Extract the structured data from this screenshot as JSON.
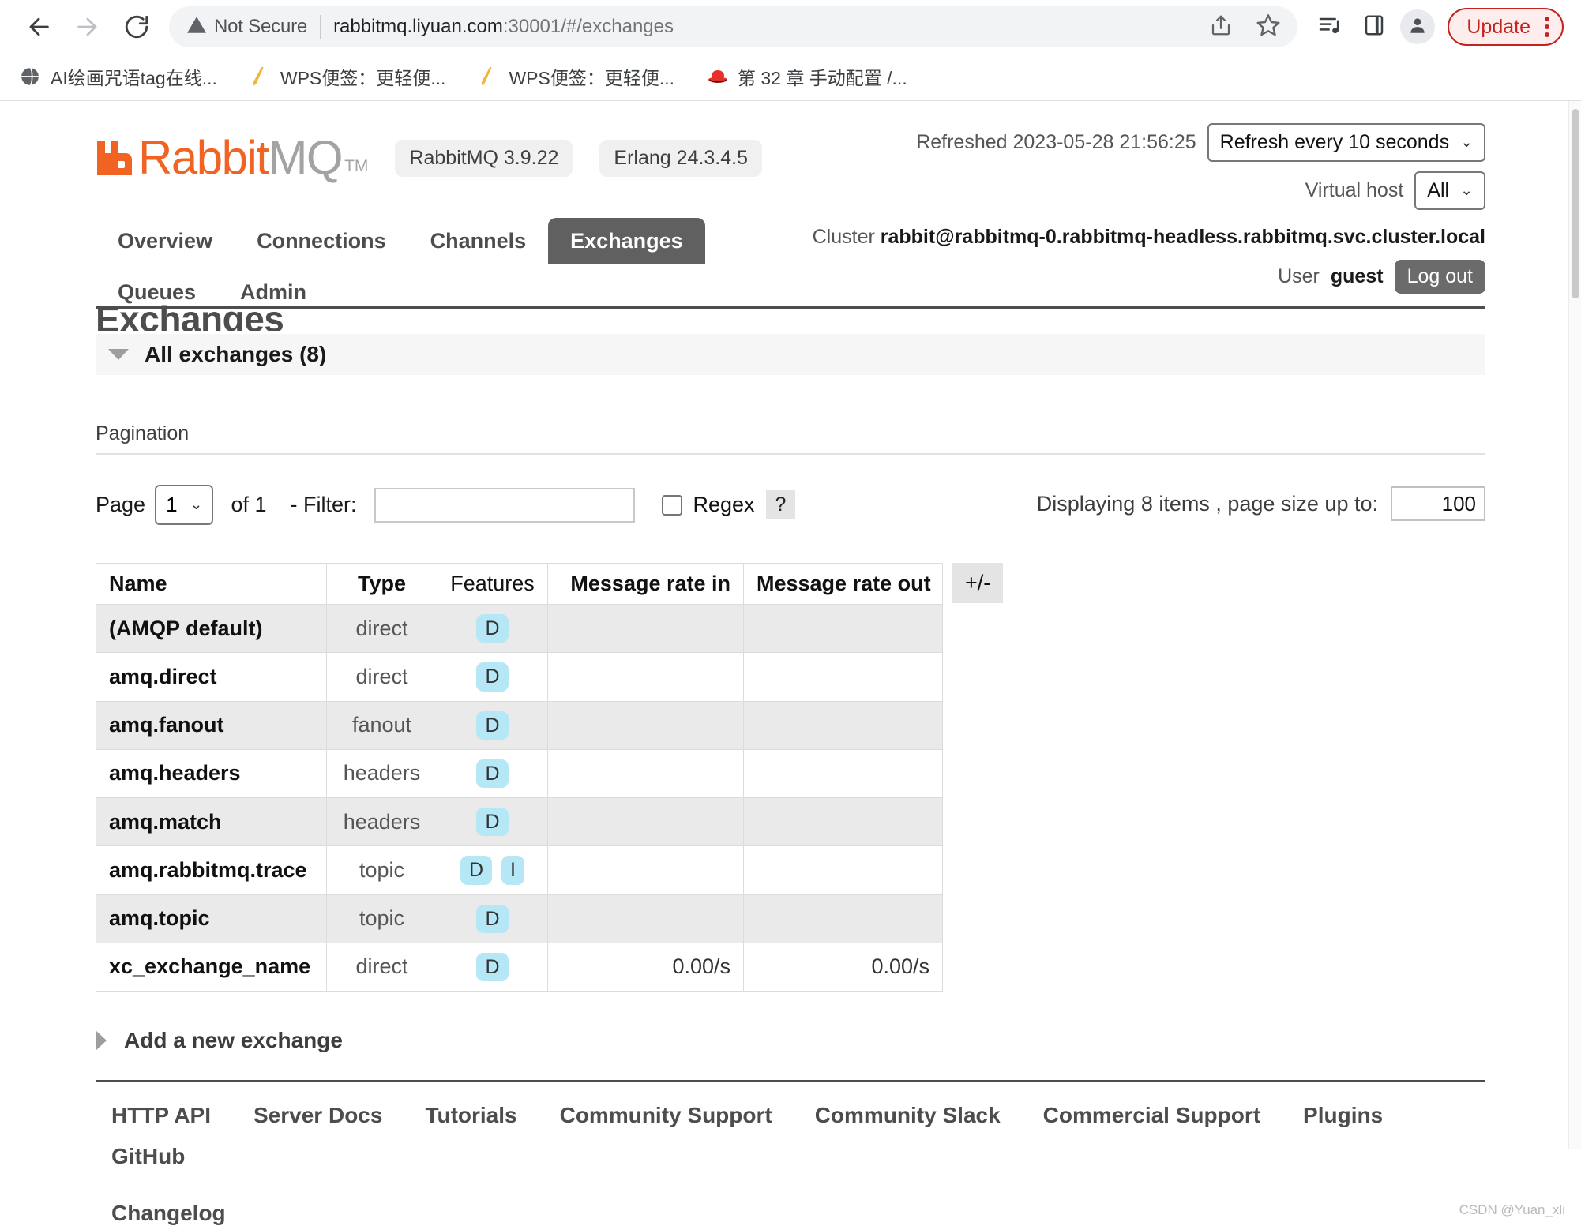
{
  "browser": {
    "back_icon": "arrow-left-icon",
    "forward_icon": "arrow-right-icon",
    "reload_icon": "reload-icon",
    "security_label": "Not Secure",
    "url_host": "rabbitmq.liyuan.com",
    "url_rest": ":30001/#/exchanges",
    "url_full": "rabbitmq.liyuan.com:30001/#/exchanges",
    "share_icon": "share-icon",
    "bookmark_icon": "star-icon",
    "reading_list_icon": "media-list-icon",
    "side_panel_icon": "side-panel-icon",
    "profile_icon": "profile-avatar-icon",
    "update_label": "Update",
    "menu_icon": "kebab-menu-icon",
    "bookmarks": [
      {
        "title": "AI绘画咒语tag在线...",
        "favicon": "globe-icon"
      },
      {
        "title": "WPS便签：更轻便...",
        "favicon": "wps-note-icon"
      },
      {
        "title": "WPS便签：更轻便...",
        "favicon": "wps-note-icon"
      },
      {
        "title": "第 32 章 手动配置 /...",
        "favicon": "redhat-icon"
      }
    ]
  },
  "header": {
    "logo_orange": "Rabbit",
    "logo_grey": "MQ",
    "logo_tm": "TM",
    "version_badge": "RabbitMQ 3.9.22",
    "erlang_badge": "Erlang 24.3.4.5",
    "refreshed_label": "Refreshed 2023-05-28 21:56:25",
    "refresh_select": "Refresh every 10 seconds",
    "vhost_label": "Virtual host",
    "vhost_select": "All",
    "cluster_label": "Cluster",
    "cluster_name": "rabbit@rabbitmq-0.rabbitmq-headless.rabbitmq.svc.cluster.local",
    "user_label": "User",
    "user_name": "guest",
    "logout_label": "Log out"
  },
  "nav": {
    "tabs": [
      {
        "label": "Overview",
        "active": false
      },
      {
        "label": "Connections",
        "active": false
      },
      {
        "label": "Channels",
        "active": false
      },
      {
        "label": "Exchanges",
        "active": true
      },
      {
        "label": "Queues",
        "active": false
      },
      {
        "label": "Admin",
        "active": false
      }
    ]
  },
  "main": {
    "page_title": "Exchanges",
    "section_title": "All exchanges (8)",
    "pagination_label": "Pagination",
    "page_label": "Page",
    "page_value": "1",
    "of_label": "of 1",
    "filter_label": "- Filter:",
    "filter_value": "",
    "filter_placeholder": "",
    "regex_label": "Regex",
    "regex_help": "?",
    "displaying_text": "Displaying 8 items , page size up to:",
    "page_size_value": "100",
    "plus_minus_label": "+/-",
    "add_exchange_label": "Add a new exchange"
  },
  "table": {
    "columns": [
      "Name",
      "Type",
      "Features",
      "Message rate in",
      "Message rate out"
    ],
    "rows": [
      {
        "name": "(AMQP default)",
        "type": "direct",
        "features": [
          "D"
        ],
        "rate_in": "",
        "rate_out": ""
      },
      {
        "name": "amq.direct",
        "type": "direct",
        "features": [
          "D"
        ],
        "rate_in": "",
        "rate_out": ""
      },
      {
        "name": "amq.fanout",
        "type": "fanout",
        "features": [
          "D"
        ],
        "rate_in": "",
        "rate_out": ""
      },
      {
        "name": "amq.headers",
        "type": "headers",
        "features": [
          "D"
        ],
        "rate_in": "",
        "rate_out": ""
      },
      {
        "name": "amq.match",
        "type": "headers",
        "features": [
          "D"
        ],
        "rate_in": "",
        "rate_out": ""
      },
      {
        "name": "amq.rabbitmq.trace",
        "type": "topic",
        "features": [
          "D",
          "I"
        ],
        "rate_in": "",
        "rate_out": ""
      },
      {
        "name": "amq.topic",
        "type": "topic",
        "features": [
          "D"
        ],
        "rate_in": "",
        "rate_out": ""
      },
      {
        "name": "xc_exchange_name",
        "type": "direct",
        "features": [
          "D"
        ],
        "rate_in": "0.00/s",
        "rate_out": "0.00/s"
      }
    ]
  },
  "footer": {
    "links": [
      "HTTP API",
      "Server Docs",
      "Tutorials",
      "Community Support",
      "Community Slack",
      "Commercial Support",
      "Plugins",
      "GitHub"
    ],
    "second_row": [
      "Changelog"
    ]
  },
  "watermark": "CSDN @Yuan_xli",
  "colors": {
    "brand_orange": "#f16322",
    "active_tab": "#606060",
    "feature_badge": "#b6e7f7",
    "update_red": "#c5221f"
  }
}
